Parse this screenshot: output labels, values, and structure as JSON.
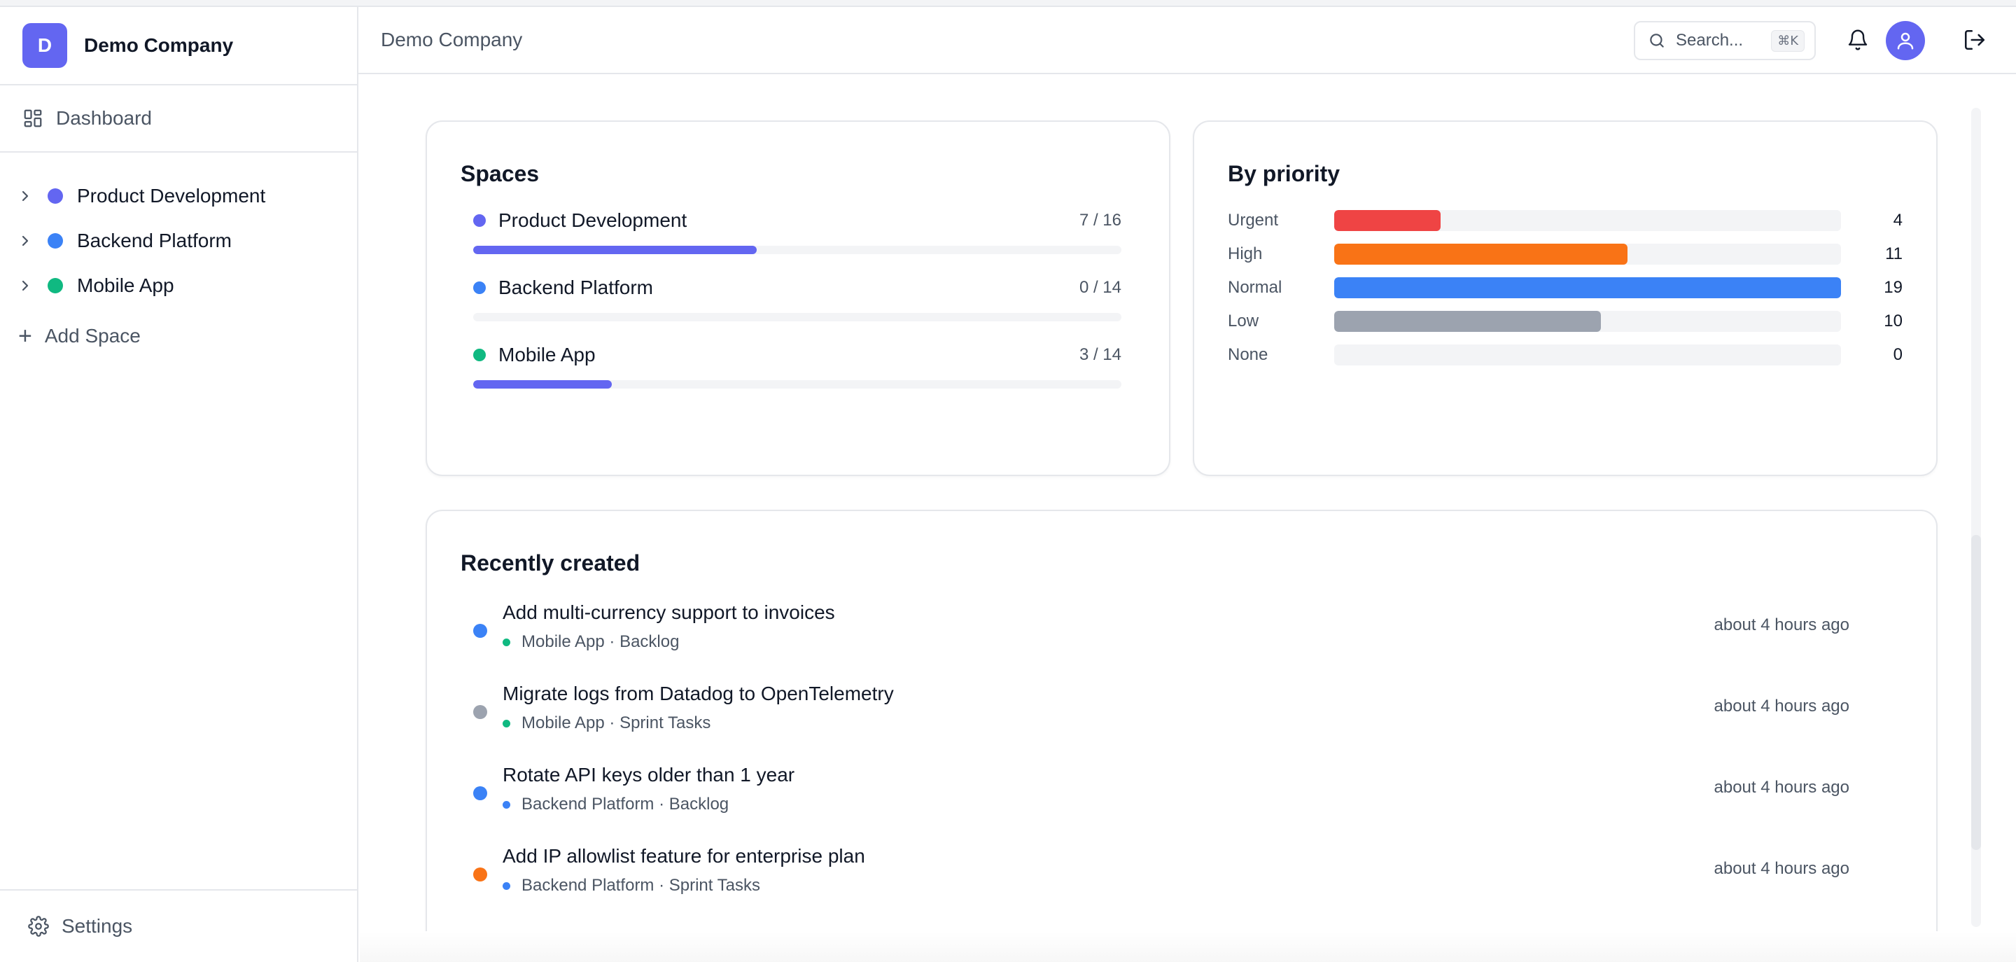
{
  "app": {
    "company_initial": "D",
    "company_name": "Demo Company"
  },
  "sidebar": {
    "dashboard_label": "Dashboard",
    "spaces": [
      {
        "name": "Product Development",
        "color": "#6366f1"
      },
      {
        "name": "Backend Platform",
        "color": "#3b82f6"
      },
      {
        "name": "Mobile App",
        "color": "#10b981"
      }
    ],
    "add_space_label": "Add Space",
    "settings_label": "Settings"
  },
  "header": {
    "title": "Demo Company",
    "search_placeholder": "Search...",
    "search_shortcut": "⌘K"
  },
  "spaces_card": {
    "title": "Spaces",
    "items": [
      {
        "name": "Product Development",
        "count": "7 / 16",
        "done": 7,
        "total": 16,
        "color": "#6366f1"
      },
      {
        "name": "Backend Platform",
        "count": "0 / 14",
        "done": 0,
        "total": 14,
        "color": "#3b82f6"
      },
      {
        "name": "Mobile App",
        "count": "3 / 14",
        "done": 3,
        "total": 14,
        "color": "#10b981"
      }
    ],
    "bar_color": "#6366f1"
  },
  "priority_card": {
    "title": "By priority",
    "items": [
      {
        "label": "Urgent",
        "value": "4",
        "color": "#ef4444"
      },
      {
        "label": "High",
        "value": "11",
        "color": "#f97316"
      },
      {
        "label": "Normal",
        "value": "19",
        "color": "#3b82f6"
      },
      {
        "label": "Low",
        "value": "10",
        "color": "#9ca3af"
      },
      {
        "label": "None",
        "value": "0",
        "color": "#d1d5db"
      }
    ],
    "max": 19
  },
  "recent_card": {
    "title": "Recently created",
    "items": [
      {
        "title": "Add multi-currency support to invoices",
        "meta": "Mobile App · Backlog",
        "time": "about 4 hours ago",
        "priority_color": "#3b82f6",
        "space_color": "#10b981"
      },
      {
        "title": "Migrate logs from Datadog to OpenTelemetry",
        "meta": "Mobile App · Sprint Tasks",
        "time": "about 4 hours ago",
        "priority_color": "#9ca3af",
        "space_color": "#10b981"
      },
      {
        "title": "Rotate API keys older than 1 year",
        "meta": "Backend Platform · Backlog",
        "time": "about 4 hours ago",
        "priority_color": "#3b82f6",
        "space_color": "#3b82f6"
      },
      {
        "title": "Add IP allowlist feature for enterprise plan",
        "meta": "Backend Platform · Sprint Tasks",
        "time": "about 4 hours ago",
        "priority_color": "#f97316",
        "space_color": "#3b82f6"
      }
    ]
  }
}
